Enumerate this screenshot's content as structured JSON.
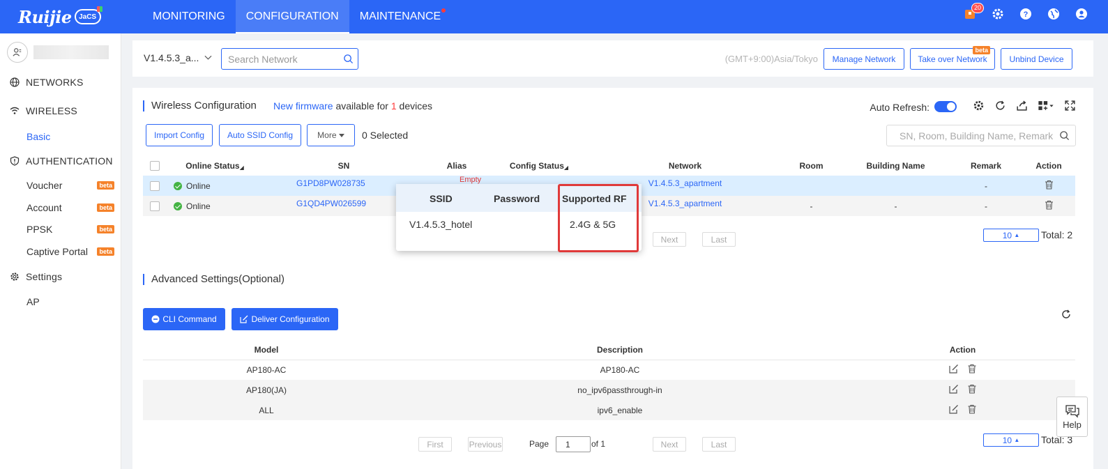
{
  "brand": {
    "logo_text": "Ruijie",
    "logo_badge": "JaCS"
  },
  "nav": {
    "items": [
      {
        "label": "MONITORING"
      },
      {
        "label": "CONFIGURATION"
      },
      {
        "label": "MAINTENANCE"
      }
    ],
    "active": "CONFIGURATION"
  },
  "topbar": {
    "notification_count": "20"
  },
  "sidebar": {
    "sections": {
      "networks": "NETWORKS",
      "wireless": "WIRELESS",
      "wireless_basic": "Basic",
      "authentication": "AUTHENTICATION",
      "voucher": "Voucher",
      "account": "Account",
      "ppsk": "PPSK",
      "captive": "Captive Portal",
      "settings": "Settings",
      "ap": "AP"
    },
    "beta_label": "beta"
  },
  "header": {
    "network_selected": "V1.4.5.3_a...",
    "search_placeholder": "Search Network",
    "timezone": "(GMT+9:00)Asia/Tokyo",
    "manage_network": "Manage Network",
    "take_over_network": "Take over Network",
    "take_over_badge": "beta",
    "unbind_device": "Unbind Device"
  },
  "wireless": {
    "title": "Wireless Configuration",
    "firmware_link": "New firmware",
    "firmware_mid": " available for ",
    "firmware_count": "1",
    "firmware_end": " devices",
    "auto_refresh_label": "Auto Refresh:",
    "import_config": "Import Config",
    "auto_ssid_config": "Auto SSID Config",
    "more": "More",
    "selected": "0 Selected",
    "search_placeholder": "SN, Room, Building Name, Remark",
    "columns": [
      "Online Status",
      "SN",
      "Alias",
      "Config Status",
      "Network",
      "Room",
      "Building Name",
      "Remark",
      "Action"
    ],
    "rows": [
      {
        "status": "Online",
        "sn": "G1PD8PW028735",
        "alias": "Empty",
        "network": "V1.4.5.3_apartment",
        "room": "",
        "building": "",
        "remark": "-"
      },
      {
        "status": "Online",
        "sn": "G1QD4PW026599",
        "alias": "",
        "network": "V1.4.5.3_apartment",
        "room": "-",
        "building": "-",
        "remark": "-"
      }
    ],
    "pager": {
      "next": "Next",
      "last": "Last",
      "page_size": "10",
      "total": "Total: 2"
    }
  },
  "popover": {
    "headers": {
      "ssid": "SSID",
      "password": "Password",
      "rf": "Supported RF"
    },
    "row": {
      "ssid": "V1.4.5.3_hotel",
      "password": "",
      "rf": "2.4G & 5G"
    }
  },
  "advanced": {
    "title": "Advanced Settings(Optional)",
    "cli_command": "CLI Command",
    "deliver_config": "Deliver Configuration",
    "columns": [
      "Model",
      "Description",
      "Action"
    ],
    "rows": [
      {
        "model": "AP180-AC",
        "description": "AP180-AC"
      },
      {
        "model": "AP180(JA)",
        "description": "no_ipv6passthrough-in"
      },
      {
        "model": "ALL",
        "description": "ipv6_enable"
      }
    ],
    "pager": {
      "first": "First",
      "previous": "Previous",
      "page_label": "Page",
      "page_value": "1",
      "of": "of 1",
      "next": "Next",
      "last": "Last",
      "page_size": "10",
      "total": "Total: 3"
    }
  },
  "help": {
    "label": "Help"
  },
  "colors": {
    "primary": "#2b66f6",
    "beta": "#f5822a",
    "online": "#44b344",
    "highlight": "#e03a3a"
  }
}
